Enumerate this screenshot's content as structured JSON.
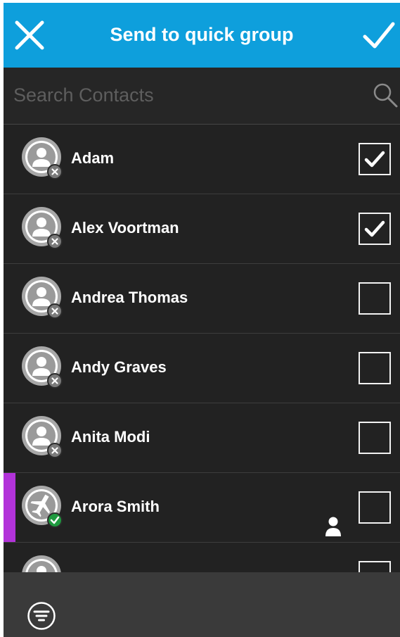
{
  "header": {
    "title": "Send to quick group",
    "close_icon": "close-icon",
    "confirm_icon": "checkmark-icon",
    "background_color": "#0e9fdc"
  },
  "search": {
    "placeholder": "Search Contacts",
    "value": "",
    "icon": "search-icon"
  },
  "contacts": [
    {
      "name": "Adam",
      "checked": true,
      "status": "unavailable",
      "avatar_icon": "person-avatar-icon"
    },
    {
      "name": "Alex Voortman",
      "checked": true,
      "status": "unavailable",
      "avatar_icon": "person-avatar-icon"
    },
    {
      "name": "Andrea Thomas",
      "checked": false,
      "status": "unavailable",
      "avatar_icon": "person-avatar-icon"
    },
    {
      "name": "Andy Graves",
      "checked": false,
      "status": "unavailable",
      "avatar_icon": "person-avatar-icon"
    },
    {
      "name": "Anita Modi",
      "checked": false,
      "status": "unavailable",
      "avatar_icon": "person-avatar-icon"
    },
    {
      "name": "Arora Smith",
      "checked": false,
      "status": "available",
      "avatar_icon": "airplane-avatar-icon",
      "accent_color": "#b233d9",
      "extra_icon": "person-icon"
    },
    {
      "name": "",
      "checked": false,
      "status": "unavailable",
      "avatar_icon": "person-avatar-icon"
    }
  ],
  "bottom_bar": {
    "filter_icon": "filter-icon"
  },
  "colors": {
    "available": "#1e9a3f",
    "unavailable": "#a8a8a8"
  }
}
